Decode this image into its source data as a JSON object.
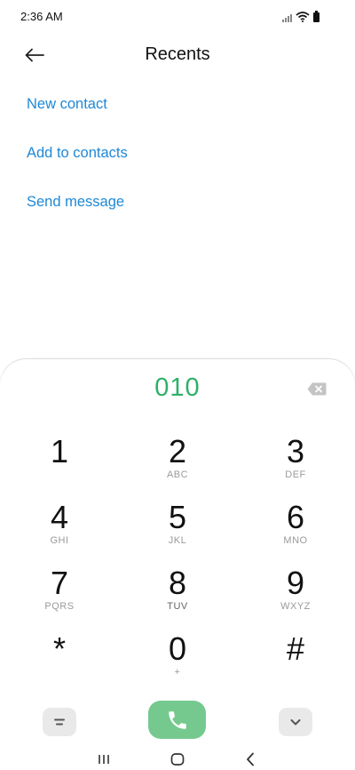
{
  "status_bar": {
    "time": "2:36 AM"
  },
  "header": {
    "title": "Recents"
  },
  "actions": [
    {
      "label": "New contact"
    },
    {
      "label": "Add to contacts"
    },
    {
      "label": "Send message"
    }
  ],
  "dialpad": {
    "number": "010",
    "keys": [
      {
        "digit": "1",
        "letters": ""
      },
      {
        "digit": "2",
        "letters": "ABC"
      },
      {
        "digit": "3",
        "letters": "DEF"
      },
      {
        "digit": "4",
        "letters": "GHI"
      },
      {
        "digit": "5",
        "letters": "JKL"
      },
      {
        "digit": "6",
        "letters": "MNO"
      },
      {
        "digit": "7",
        "letters": "PQRS"
      },
      {
        "digit": "8",
        "letters": "TUV"
      },
      {
        "digit": "9",
        "letters": "WXYZ"
      },
      {
        "digit": "*",
        "letters": ""
      },
      {
        "digit": "0",
        "letters": "+"
      },
      {
        "digit": "#",
        "letters": ""
      }
    ]
  },
  "colors": {
    "accent_link": "#1e88d6",
    "number_green": "#2eb068",
    "call_button": "#75c98f"
  },
  "icons": {
    "back": "arrow-left-icon",
    "backspace": "backspace-icon",
    "menu": "menu-icon",
    "call": "phone-icon",
    "collapse": "chevron-down-icon",
    "nav_recents": "recent-apps-icon",
    "nav_home": "home-icon",
    "nav_back": "nav-back-icon"
  }
}
